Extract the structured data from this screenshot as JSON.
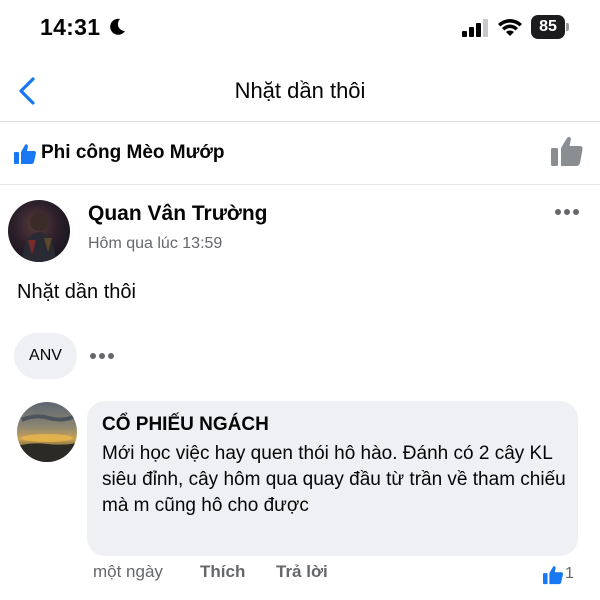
{
  "status_bar": {
    "time": "14:31",
    "battery": "85"
  },
  "nav": {
    "title": "Nhặt dần thôi"
  },
  "reactions": {
    "reactor_name": "Phi công Mèo Mướp"
  },
  "post": {
    "author": "Quan Vân Trường",
    "time": "Hôm qua lúc 13:59",
    "text": "Nhặt dần thôi"
  },
  "reactor_chip": {
    "label": "ANV"
  },
  "comment": {
    "author": "CỔ PHIẾU NGÁCH",
    "text": "Mới học việc hay quen thói hô hào. Đánh có 2 cây KL siêu đỉnh, cây hôm qua quay đầu từ trần về tham chiếu mà m cũng hô cho được",
    "time": "một ngày",
    "like_label": "Thích",
    "reply_label": "Trả lời",
    "like_count": "1"
  },
  "colors": {
    "accent": "#1877f2",
    "muted": "#65676b",
    "bubble": "#eff0f3"
  },
  "icons": [
    "moon-icon",
    "signal-icon",
    "wifi-icon",
    "back-icon",
    "thumbs-up-icon",
    "more-icon"
  ]
}
